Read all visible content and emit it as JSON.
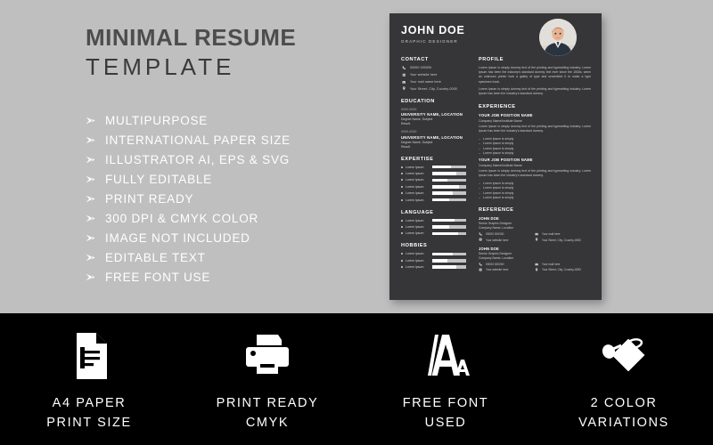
{
  "promo": {
    "title_line1": "MINIMAL RESUME",
    "title_line2": "TEMPLATE",
    "features": [
      "MULTIPURPOSE",
      "INTERNATIONAL PAPER SIZE",
      "ILLUSTRATOR AI, EPS & SVG",
      "FULLY EDITABLE",
      "PRINT READY",
      "300 DPI & CMYK COLOR",
      "IMAGE NOT INCLUDED",
      "EDITABLE TEXT",
      "FREE FONT USE"
    ]
  },
  "resume": {
    "name": "JOHN DOE",
    "role": "GRAPHIC DESIGNER",
    "contact": {
      "title": "CONTACT",
      "items": [
        {
          "icon": "phone-icon",
          "text": "00000 000000"
        },
        {
          "icon": "globe-icon",
          "text": "Your website here"
        },
        {
          "icon": "mail-icon",
          "text": "Your mail name here"
        },
        {
          "icon": "location-icon",
          "text": "Your Street, City, Country-0000"
        }
      ]
    },
    "education": {
      "title": "EDUCATION",
      "entries": [
        {
          "date": "0000-0000",
          "university": "UNIVERSITY NAME, LOCATION",
          "degree": "Degree Name, Subject",
          "result": "Result."
        },
        {
          "date": "0000-0000",
          "university": "UNIVERSITY NAME, LOCATION",
          "degree": "Degree Name, Subject",
          "result": "Result."
        }
      ]
    },
    "expertise": {
      "title": "EXPERTISE",
      "items": [
        {
          "label": "Lorem Ipsum",
          "value": 55
        },
        {
          "label": "Lorem Ipsum",
          "value": 70
        },
        {
          "label": "Lorem Ipsum",
          "value": 45
        },
        {
          "label": "Lorem Ipsum",
          "value": 80
        },
        {
          "label": "Lorem Ipsum",
          "value": 60
        },
        {
          "label": "Lorem Ipsum",
          "value": 50
        }
      ]
    },
    "language": {
      "title": "LANGUAGE",
      "items": [
        {
          "label": "Lorem Ipsum",
          "value": 65
        },
        {
          "label": "Lorem Ipsum",
          "value": 50
        },
        {
          "label": "Lorem Ipsum",
          "value": 75
        }
      ]
    },
    "hobbies": {
      "title": "HOBBIES",
      "items": [
        {
          "label": "Lorem Ipsum",
          "value": 60
        },
        {
          "label": "Lorem Ipsum",
          "value": 45
        },
        {
          "label": "Lorem Ipsum",
          "value": 70
        }
      ]
    },
    "profile": {
      "title": "PROFILE",
      "paragraphs": [
        "Lorem Ipsum is simply dummy text of the printing and typesetting industry. Lorem Ipsum has been the industry's standard dummy text ever since the 1500s, when an unknown printer took a galley of type and scrambled it to make a type specimen book.",
        "Lorem Ipsum is simply dummy text of the printing and typesetting industry. Lorem Ipsum has been the industry's standard dummy"
      ]
    },
    "experience": {
      "title": "EXPERIENCE",
      "entries": [
        {
          "job_title": "YOUR JOB POSITION NAME",
          "company": "Company Name/Institute Name",
          "description": "Lorem Ipsum is simply dummy text of the printing and typesetting industry. Lorem Ipsum has been the industry's standard dummy.",
          "bullets": [
            "Lorem Ipsum is simply",
            "Lorem Ipsum is simply",
            "Lorem Ipsum is simply",
            "Lorem Ipsum is simply"
          ]
        },
        {
          "job_title": "YOUR JOB POSITION NAME",
          "company": "Company Name/Institute Name",
          "description": "Lorem Ipsum is simply dummy text of the printing and typesetting industry. Lorem Ipsum has been the industry's standard dummy.",
          "bullets": [
            "Lorem Ipsum is simply",
            "Lorem Ipsum is simply",
            "Lorem Ipsum is simply",
            "Lorem Ipsum is simply"
          ]
        }
      ]
    },
    "reference": {
      "title": "REFERENCE",
      "entries": [
        {
          "name": "JOHN DOE",
          "role": "Senior Graphic Designer",
          "company": "Company Name, Location",
          "contacts": [
            {
              "icon": "phone-icon",
              "text": "00000 000000"
            },
            {
              "icon": "mail-icon",
              "text": "Your mail here"
            },
            {
              "icon": "globe-icon",
              "text": "Your website here"
            },
            {
              "icon": "location-icon",
              "text": "Your Street, City, Country-0000"
            }
          ]
        },
        {
          "name": "JOHN DOE",
          "role": "Senior Graphic Designer",
          "company": "Company Name, Location",
          "contacts": [
            {
              "icon": "phone-icon",
              "text": "00000 000000"
            },
            {
              "icon": "mail-icon",
              "text": "Your mail here"
            },
            {
              "icon": "globe-icon",
              "text": "Your website here"
            },
            {
              "icon": "location-icon",
              "text": "Your Street, City, Country-0000"
            }
          ]
        }
      ]
    }
  },
  "bottom_badges": [
    {
      "icon": "document-icon",
      "line1": "A4 PAPER",
      "line2": "PRINT SIZE"
    },
    {
      "icon": "printer-icon",
      "line1": "PRINT READY",
      "line2": "CMYK"
    },
    {
      "icon": "font-aa-icon",
      "line1": "FREE FONT",
      "line2": "USED"
    },
    {
      "icon": "color-swatch-icon",
      "line1": "2 COLOR",
      "line2": "VARIATIONS"
    }
  ],
  "colors": {
    "page_bg": "#bfbfbf",
    "bottom_bg": "#000000",
    "card_bg": "#363639",
    "title_dark": "#4d4d4d",
    "text_white": "#ffffff"
  }
}
